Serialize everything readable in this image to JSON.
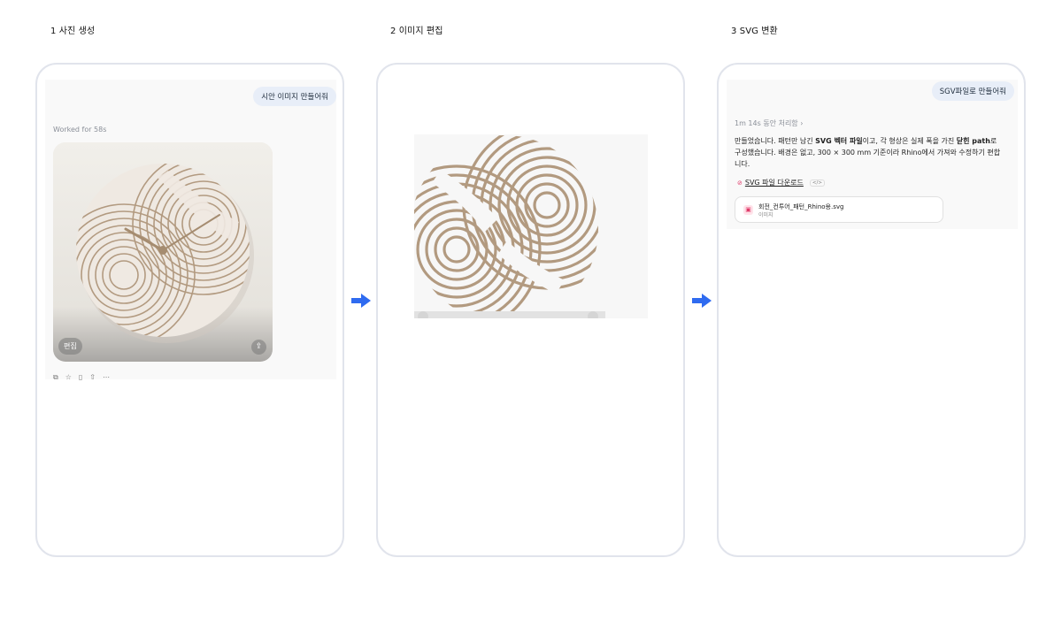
{
  "steps": [
    {
      "label": "1  사진 생성"
    },
    {
      "label": "2  이미지 편집"
    },
    {
      "label": "3  SVG 변환"
    }
  ],
  "panel1": {
    "user_message": "시안 이미지 만들어줘",
    "status": "Worked for 58s",
    "image": {
      "edit_label": "편집",
      "share_icon": "share-icon",
      "subject": "wall-clock-with-swirl-line-pattern"
    },
    "actions": [
      "copy-icon",
      "like-icon",
      "bookmark-icon",
      "share-icon",
      "more-icon"
    ]
  },
  "panel2": {
    "preview_subject": "swirl-line-pattern-graphic"
  },
  "panel3": {
    "user_message": "SGV파일로 만들어줘",
    "status": "1m 14s 동안 처리함",
    "message": {
      "t1": "만들었습니다. 패턴만 남긴 ",
      "b1": "SVG 벡터 파일",
      "t2": "이고, 각 형상은 실제 폭을 가진 ",
      "b2": "닫힌 path",
      "t3": "로 구성했습니다. 배경은 없고, 300 × 300 mm 기준이라 Rhino에서 가져와 수정하기 편합니다."
    },
    "download_label": "SVG 파일 다운로드",
    "download_chip": "</>",
    "file": {
      "name": "회전_컨투어_패턴_Rhino용.svg",
      "type": "이미지"
    }
  },
  "colors": {
    "accent_arrow": "#2f6bf0",
    "line_pattern": "#b29a80",
    "bubble": "#e8eef8"
  }
}
